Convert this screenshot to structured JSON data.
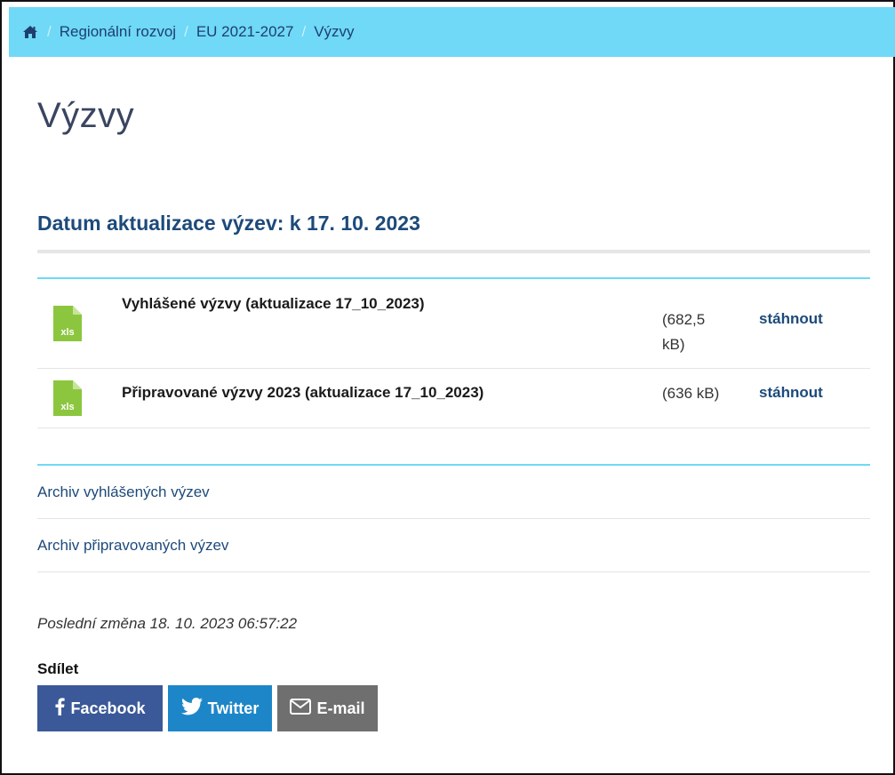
{
  "breadcrumb": {
    "home_icon": "home-icon",
    "items": [
      "Regionální rozvoj",
      "EU 2021-2027"
    ],
    "current": "Výzvy",
    "separator": "/",
    "bg_color": "#6fd9f7"
  },
  "page": {
    "title": "Výzvy",
    "subtitle": "Datum aktualizace výzev: k 17. 10. 2023"
  },
  "files": [
    {
      "icon": "xls-file-icon",
      "icon_text": "xls",
      "name": "Vyhlášené výzvy (aktualizace 17_10_2023)",
      "size": "(682,5 kB)",
      "download_label": "stáhnout"
    },
    {
      "icon": "xls-file-icon",
      "icon_text": "xls",
      "name": "Připravované výzvy 2023 (aktualizace 17_10_2023)",
      "size": "(636 kB)",
      "download_label": "stáhnout"
    }
  ],
  "links": [
    "Archiv vyhlášených výzev",
    "Archiv připravovaných výzev"
  ],
  "footer": {
    "last_change": "Poslední změna 18. 10. 2023 06:57:22",
    "share_label": "Sdílet",
    "buttons": [
      {
        "label": "Facebook",
        "icon": "facebook-icon",
        "color": "#3b5998"
      },
      {
        "label": "Twitter",
        "icon": "twitter-icon",
        "color": "#1d86c8"
      },
      {
        "label": "E-mail",
        "icon": "envelope-icon",
        "color": "#6f6f6f"
      }
    ]
  }
}
